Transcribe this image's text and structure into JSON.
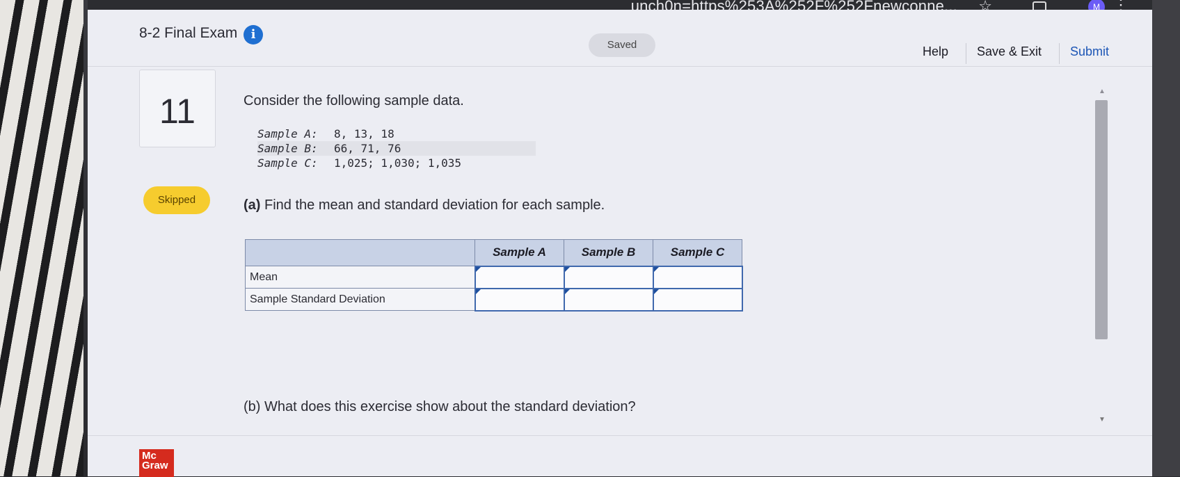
{
  "browser": {
    "url_fragment": "unch0n=https%253A%252F%252Fnewconne...",
    "profile_initial": "M"
  },
  "header": {
    "exam_title": "8-2 Final Exam",
    "saved_label": "Saved",
    "help_label": "Help",
    "save_exit_label": "Save & Exit",
    "submit_label": "Submit"
  },
  "question": {
    "number": "11",
    "status": "Skipped",
    "prompt": "Consider the following sample data.",
    "samples": [
      {
        "label": "Sample A:",
        "values": "8, 13, 18"
      },
      {
        "label": "Sample B:",
        "values": "66, 71, 76"
      },
      {
        "label": "Sample C:",
        "values": "1,025; 1,030; 1,035"
      }
    ],
    "part_a_prefix": "(a)",
    "part_a_text": "Find the mean and standard deviation for each sample.",
    "part_b": "(b) What does this exercise show about the standard deviation?"
  },
  "answer_table": {
    "columns": [
      "Sample A",
      "Sample B",
      "Sample C"
    ],
    "rows": [
      {
        "label": "Mean",
        "values": [
          "",
          "",
          ""
        ]
      },
      {
        "label": "Sample Standard Deviation",
        "values": [
          "",
          "",
          ""
        ]
      }
    ]
  },
  "footer": {
    "logo_text": "Mc Graw"
  }
}
